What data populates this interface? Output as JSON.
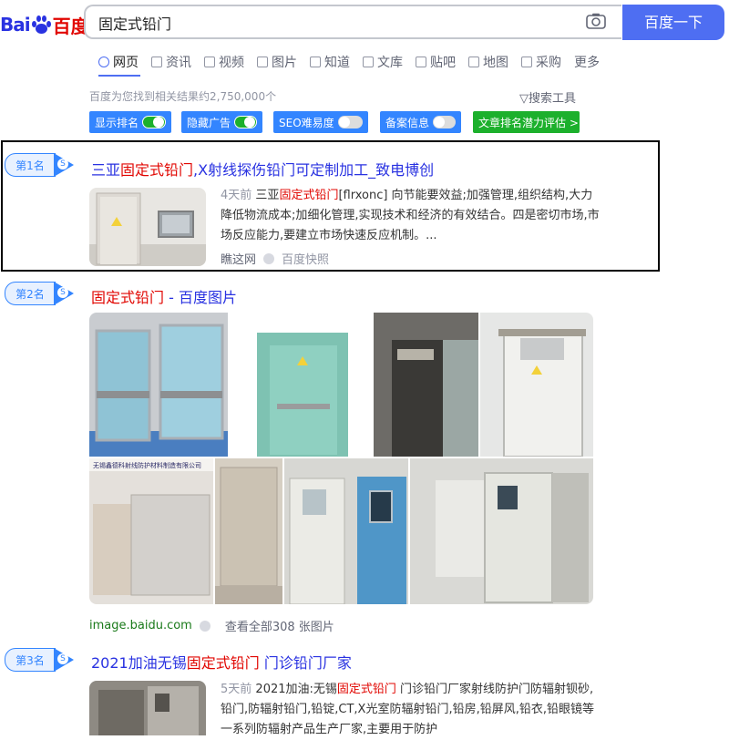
{
  "header": {
    "logo_bai": "Bai",
    "logo_du": "du",
    "logo_cn": "百度",
    "query": "固定式铅门",
    "search_button": "百度一下"
  },
  "tabs": [
    {
      "label": "网页",
      "icon": "search-icon",
      "active": true
    },
    {
      "label": "资讯",
      "icon": "news-icon"
    },
    {
      "label": "视频",
      "icon": "video-icon"
    },
    {
      "label": "图片",
      "icon": "image-icon"
    },
    {
      "label": "知道",
      "icon": "question-icon"
    },
    {
      "label": "文库",
      "icon": "doc-icon"
    },
    {
      "label": "贴吧",
      "icon": "tieba-icon"
    },
    {
      "label": "地图",
      "icon": "map-icon"
    },
    {
      "label": "采购",
      "icon": "cart-icon"
    },
    {
      "label": "更多"
    }
  ],
  "stats": "百度为您找到相关结果约2,750,000个",
  "tools": "搜索工具",
  "seo_toolbar": {
    "show_rank": "显示排名",
    "hide_ads": "隐藏广告",
    "seo_difficulty": "SEO难易度",
    "icp": "备案信息",
    "evaluate": "文章排名潜力评估 >"
  },
  "results": [
    {
      "rank": "第1名",
      "title_pre": "三亚",
      "title_hl": "固定式铅门",
      "title_post": ",X射线探伤铅门可定制加工_致电博创",
      "date": "4天前",
      "snippet_pre": "三亚",
      "snippet_hl": "固定式铅门",
      "snippet_post": "[flrxonc] 向节能要效益;加强管理,组织结构,大力降低物流成本;加细化管理,实现技术和经济的有效结合。四是密切市场,市场反应能力,要建立市场快速反应机制。...",
      "source": "瞧这网",
      "snapshot": "百度快照"
    },
    {
      "rank": "第2名",
      "title_hl": "固定式铅门",
      "title_post": " - 百度图片",
      "source": "image.baidu.com",
      "view_all": "查看全部308 张图片",
      "watermark": "无锡鑫德科射线防护材料制造有限公司"
    },
    {
      "rank": "第3名",
      "title_pre": "2021加油无锡",
      "title_hl": "固定式铅门",
      "title_post": " 门诊铅门厂家",
      "date": "5天前",
      "snippet_pre": "2021加油:无锡",
      "snippet_hl": "固定式铅门",
      "snippet_post": " 门诊铅门厂家射线防护门防辐射钡砂,铅门,防辐射铅门,铅锭,CT,X光室防辐射铅门,铅房,铅屏风,铅衣,铅眼镜等一系列防辐射产品生产厂家,主要用于防护"
    }
  ],
  "colors": {
    "link": "#2932e1",
    "highlight": "#e10601",
    "brand_blue": "#4e6ef2",
    "badge_blue": "#3385ff",
    "green": "#1cb02c"
  }
}
